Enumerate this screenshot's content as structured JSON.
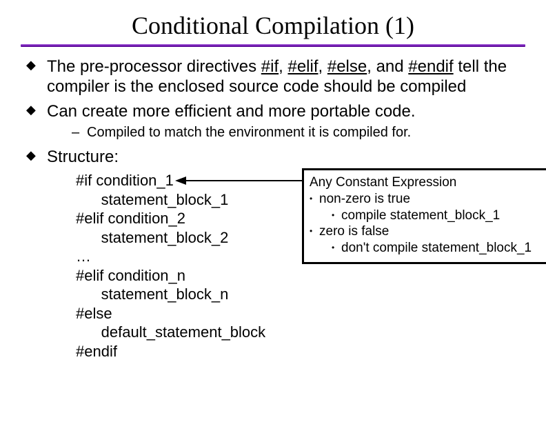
{
  "title": "Conditional Compilation (1)",
  "bullets": {
    "b1_pre": "The pre-processor directives ",
    "b1_dir1": "#if",
    "b1_sep1": ", ",
    "b1_dir2": "#elif",
    "b1_sep2": ", ",
    "b1_dir3": "#else",
    "b1_sep3": ", and ",
    "b1_dir4": "#endif",
    "b1_post": " tell the compiler is the enclosed source code should be compiled",
    "b2": "Can create more efficient and more portable code.",
    "b2_sub": "Compiled to match the environment it is compiled for.",
    "b3": "Structure:"
  },
  "code": {
    "l1": "#if condition_1",
    "l2": "      statement_block_1",
    "l3": "#elif condition_2",
    "l4": "      statement_block_2",
    "l5": "…",
    "l6": "#elif condition_n",
    "l7": "      statement_block_n",
    "l8": "#else",
    "l9": "      default_statement_block",
    "l10": "#endif"
  },
  "callout": {
    "title": "Any Constant Expression",
    "nz": "non-zero is true",
    "nz_sub": "compile statement_block_1",
    "z": "zero is false",
    "z_sub": "don't compile statement_block_1"
  }
}
